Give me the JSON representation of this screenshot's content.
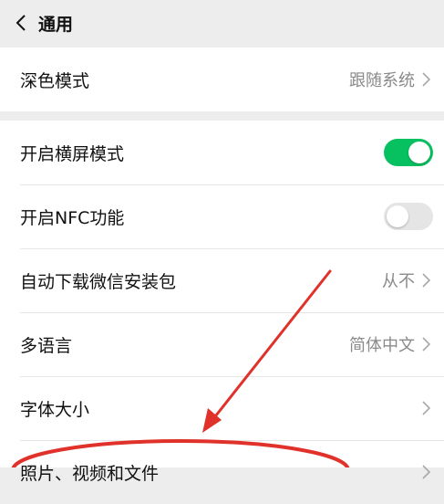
{
  "header": {
    "title": "通用",
    "back_icon": "chevron-left-icon"
  },
  "dark_mode": {
    "label": "深色模式",
    "value": "跟随系统"
  },
  "settings": {
    "landscape": {
      "label": "开启横屏模式",
      "toggle": "on"
    },
    "nfc": {
      "label": "开启NFC功能",
      "toggle": "off"
    },
    "auto_download": {
      "label": "自动下载微信安装包",
      "value": "从不"
    },
    "language": {
      "label": "多语言",
      "value": "简体中文"
    },
    "font_size": {
      "label": "字体大小"
    },
    "media": {
      "label": "照片、视频和文件"
    }
  },
  "colors": {
    "toggle_on": "#07c160",
    "toggle_off": "#e5e5e5",
    "annotation": "#e0312b"
  }
}
